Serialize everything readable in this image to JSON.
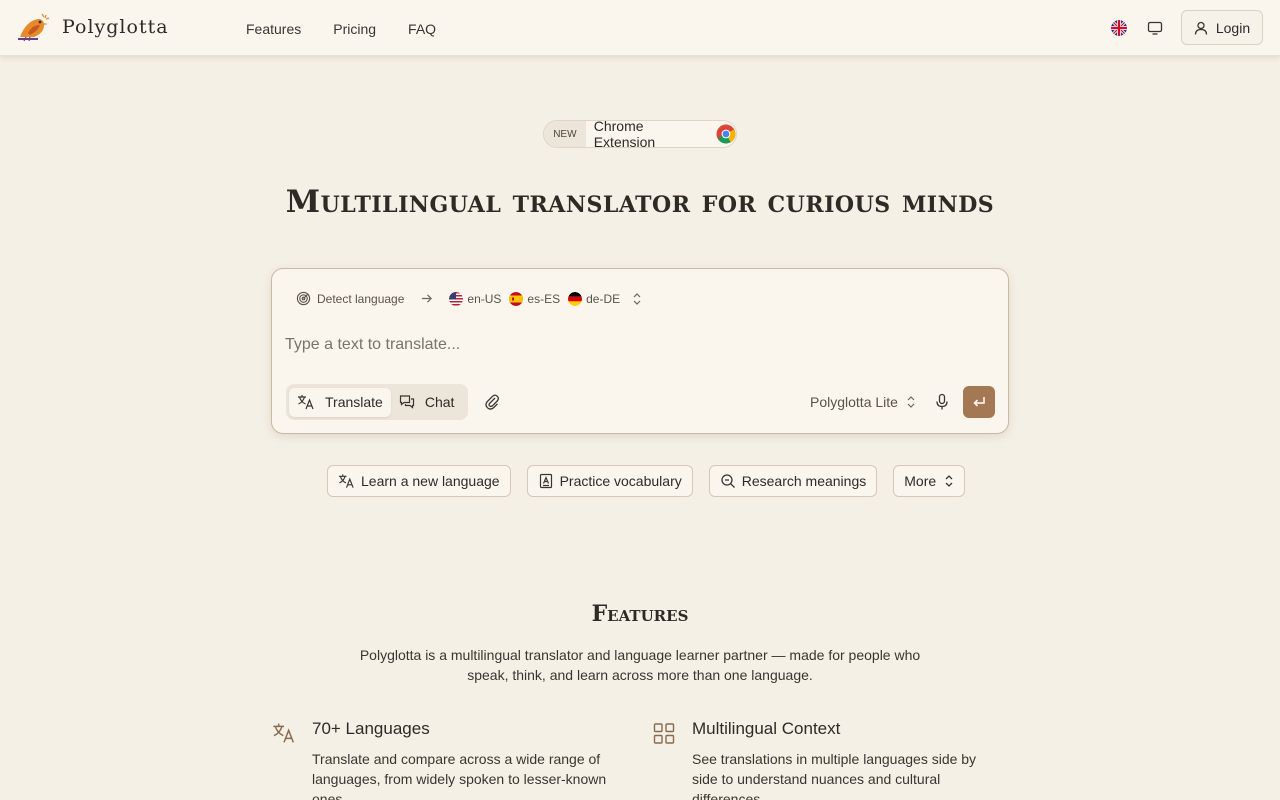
{
  "header": {
    "brand": "Polyglotta",
    "nav": [
      "Features",
      "Pricing",
      "FAQ"
    ],
    "login_label": "Login"
  },
  "badge": {
    "new_label": "NEW",
    "text": "Chrome Extension"
  },
  "hero": {
    "title": "Multilingual translator for curious minds"
  },
  "translator": {
    "detect_label": "Detect language",
    "target_langs": [
      "en-US",
      "es-ES",
      "de-DE"
    ],
    "placeholder": "Type a text to translate...",
    "mode_translate": "Translate",
    "mode_chat": "Chat",
    "model": "Polyglotta Lite"
  },
  "suggestions": [
    "Learn a new language",
    "Practice vocabulary",
    "Research meanings",
    "More"
  ],
  "features": {
    "title": "Features",
    "description": "Polyglotta is a multilingual translator and language learner partner — made for people who speak, think, and learn across more than one language.",
    "items": [
      {
        "title": "70+ Languages",
        "text": "Translate and compare across a wide range of languages, from widely spoken to lesser-known ones."
      },
      {
        "title": "Multilingual Context",
        "text": "See translations in multiple languages side by side to understand nuances and cultural differences."
      }
    ]
  },
  "colors": {
    "background": "#f5f0e6",
    "accent": "#a47852",
    "surface": "#faf6ee"
  }
}
